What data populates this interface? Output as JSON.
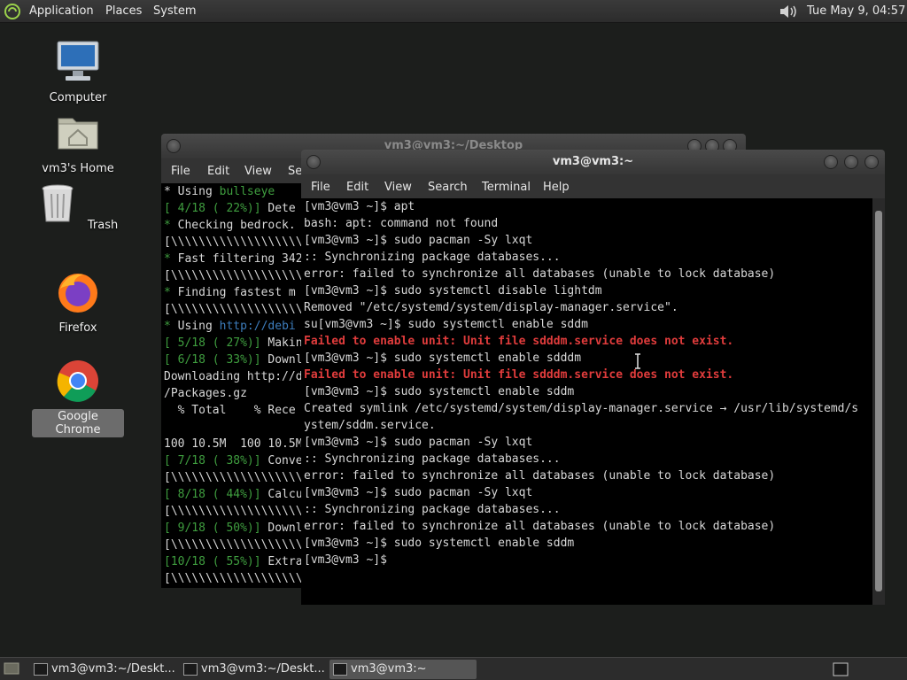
{
  "top_panel": {
    "menus": [
      "Applications",
      "Places",
      "System"
    ],
    "clock": "Tue May  9, 04:57",
    "icons": {
      "logo": "gnome-foot-icon",
      "volume": "speaker-icon"
    }
  },
  "desktop_icons": [
    {
      "label": "Computer",
      "icon": "computer-icon"
    },
    {
      "label": "vm3's Home",
      "icon": "home-folder-icon"
    },
    {
      "label": "Trash",
      "icon": "trash-icon"
    },
    {
      "label": "Firefox",
      "icon": "firefox-icon"
    },
    {
      "label": "Google Chrome",
      "icon": "chrome-icon",
      "selected": true
    }
  ],
  "back_window": {
    "title": "vm3@vm3:~/Desktop",
    "menu": [
      "File",
      "Edit",
      "View",
      "Se"
    ],
    "lines": [
      [
        {
          "t": "* Using "
        },
        {
          "t": "bullseye",
          "c": "green"
        }
      ],
      [
        {
          "t": "[ 4/18 ( 22%)] ",
          "c": "green"
        },
        {
          "t": "Dete"
        }
      ],
      [
        {
          "t": "* ",
          "c": "green"
        },
        {
          "t": "Checking bedrock."
        }
      ],
      [
        {
          "t": "[\\\\\\\\\\\\\\\\\\\\\\\\\\\\\\\\\\\\\\\\\\\\\\\\"
        }
      ],
      [
        {
          "t": "* ",
          "c": "green"
        },
        {
          "t": "Fast filtering 342"
        }
      ],
      [
        {
          "t": "[\\\\\\\\\\\\\\\\\\\\\\\\\\\\\\\\\\\\\\\\\\\\\\\\"
        }
      ],
      [
        {
          "t": "* ",
          "c": "green"
        },
        {
          "t": "Finding fastest m"
        }
      ],
      [
        {
          "t": "[\\\\\\\\\\\\\\\\\\\\\\\\\\\\\\\\\\\\\\\\\\\\\\\\"
        }
      ],
      [
        {
          "t": "* ",
          "c": "green"
        },
        {
          "t": "Using "
        },
        {
          "t": "http://debi",
          "c": "link"
        }
      ],
      [
        {
          "t": "[ 5/18 ( 27%)] ",
          "c": "green"
        },
        {
          "t": "Makin"
        }
      ],
      [
        {
          "t": "[ 6/18 ( 33%)] ",
          "c": "green"
        },
        {
          "t": "Downl"
        }
      ],
      [
        {
          "t": "Downloading http://d"
        }
      ],
      [
        {
          "t": "/Packages.gz"
        }
      ],
      [
        {
          "t": "  % Total    % Rece"
        }
      ],
      [
        {
          "t": ""
        }
      ],
      [
        {
          "t": "100 10.5M  100 10.5M"
        }
      ],
      [
        {
          "t": "[ 7/18 ( 38%)] ",
          "c": "green"
        },
        {
          "t": "Conve"
        }
      ],
      [
        {
          "t": "[\\\\\\\\\\\\\\\\\\\\\\\\\\\\\\\\\\\\\\\\\\\\\\\\"
        }
      ],
      [
        {
          "t": "[ 8/18 ( 44%)] ",
          "c": "green"
        },
        {
          "t": "Calcu"
        }
      ],
      [
        {
          "t": "[\\\\\\\\\\\\\\\\\\\\\\\\\\\\\\\\\\\\\\\\\\\\\\\\"
        }
      ],
      [
        {
          "t": "[ 9/18 ( 50%)] ",
          "c": "green"
        },
        {
          "t": "Downl"
        }
      ],
      [
        {
          "t": "[\\\\\\\\\\\\\\\\\\\\\\\\\\\\\\\\\\\\\\\\\\\\\\\\"
        }
      ],
      [
        {
          "t": "[10/18 ( 55%)] ",
          "c": "green"
        },
        {
          "t": "Extra"
        }
      ],
      [
        {
          "t": "[\\\\\\\\\\\\\\\\\\\\\\\\\\\\\\\\\\\\\\\\\\\\\\\\"
        }
      ]
    ]
  },
  "front_window": {
    "title": "vm3@vm3:~",
    "menu": [
      "File",
      "Edit",
      "View",
      "Search",
      "Terminal",
      "Help"
    ],
    "lines": [
      [
        {
          "t": "[vm3@vm3 ~]$ apt"
        }
      ],
      [
        {
          "t": "bash: apt: command not found"
        }
      ],
      [
        {
          "t": "[vm3@vm3 ~]$ sudo pacman -Sy lxqt"
        }
      ],
      [
        {
          "t": ":: Synchronizing package databases..."
        }
      ],
      [
        {
          "t": "error: failed to synchronize all databases (unable to lock database)"
        }
      ],
      [
        {
          "t": "[vm3@vm3 ~]$ sudo systemctl disable lightdm"
        }
      ],
      [
        {
          "t": "Removed \"/etc/systemd/system/display-manager.service\"."
        }
      ],
      [
        {
          "t": "su[vm3@vm3 ~]$ sudo systemctl enable sddm"
        }
      ],
      [
        {
          "t": "Failed to enable unit: Unit file sdddm.service does not exist.",
          "c": "err"
        }
      ],
      [
        {
          "t": "[vm3@vm3 ~]$ sudo systemctl enable sdddm"
        }
      ],
      [
        {
          "t": "Failed to enable unit: Unit file sdddm.service does not exist.",
          "c": "err"
        }
      ],
      [
        {
          "t": "[vm3@vm3 ~]$ sudo systemctl enable sddm"
        }
      ],
      [
        {
          "t": "Created symlink /etc/systemd/system/display-manager.service → /usr/lib/systemd/s"
        }
      ],
      [
        {
          "t": "ystem/sddm.service."
        }
      ],
      [
        {
          "t": "[vm3@vm3 ~]$ sudo pacman -Sy lxqt"
        }
      ],
      [
        {
          "t": ":: Synchronizing package databases..."
        }
      ],
      [
        {
          "t": "error: failed to synchronize all databases (unable to lock database)"
        }
      ],
      [
        {
          "t": "[vm3@vm3 ~]$ sudo pacman -Sy lxqt"
        }
      ],
      [
        {
          "t": ":: Synchronizing package databases..."
        }
      ],
      [
        {
          "t": "error: failed to synchronize all databases (unable to lock database)"
        }
      ],
      [
        {
          "t": "[vm3@vm3 ~]$ sudo systemctl enable sddm"
        }
      ],
      [
        {
          "t": "[vm3@vm3 ~]$ "
        }
      ]
    ]
  },
  "taskbar": {
    "tasks": [
      {
        "label": "vm3@vm3:~/Deskt...",
        "active": false
      },
      {
        "label": "vm3@vm3:~/Deskt...",
        "active": false
      },
      {
        "label": "vm3@vm3:~",
        "active": true
      }
    ]
  }
}
